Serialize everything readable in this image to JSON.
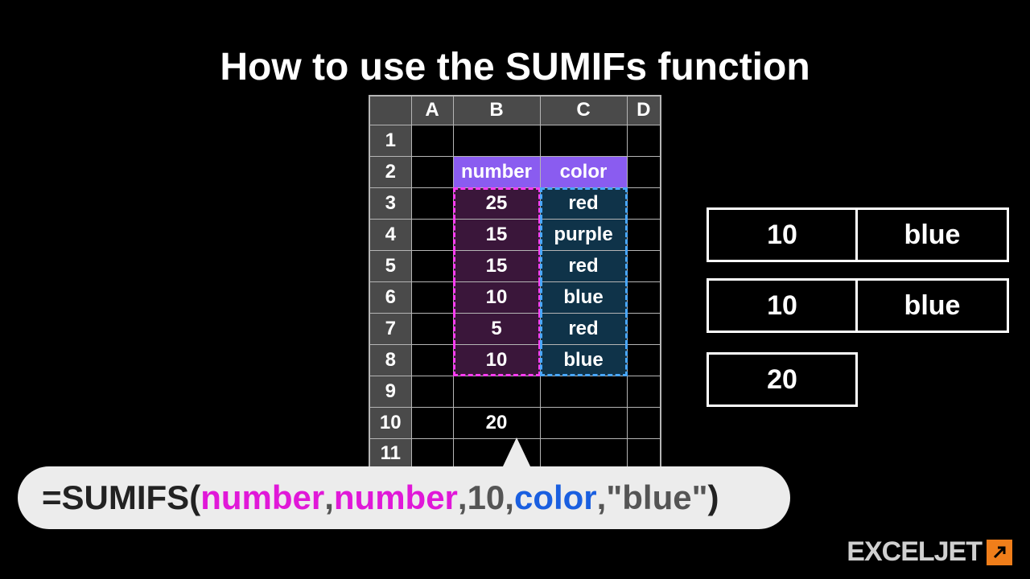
{
  "title": "How to use the SUMIFs function",
  "columns": {
    "A": "A",
    "B": "B",
    "C": "C",
    "D": "D"
  },
  "rows": [
    "1",
    "2",
    "3",
    "4",
    "5",
    "6",
    "7",
    "8",
    "9",
    "10",
    "11"
  ],
  "headers": {
    "number": "number",
    "color": "color"
  },
  "data": [
    {
      "num": "25",
      "col": "red"
    },
    {
      "num": "15",
      "col": "purple"
    },
    {
      "num": "15",
      "col": "red"
    },
    {
      "num": "10",
      "col": "blue"
    },
    {
      "num": "5",
      "col": "red"
    },
    {
      "num": "10",
      "col": "blue"
    }
  ],
  "result": "20",
  "side": {
    "row1": {
      "num": "10",
      "col": "blue"
    },
    "row2": {
      "num": "10",
      "col": "blue"
    },
    "sum": "20"
  },
  "formula": {
    "eq": "=",
    "fn": "SUMIFS",
    "open": "(",
    "a1": "number",
    "c1": ",",
    "a2": "number",
    "c2": ",",
    "a3": "10",
    "c3": ",",
    "a4": "color",
    "c4": ",",
    "a5": "\"blue\"",
    "close": ")"
  },
  "logo": "EXCELJET"
}
